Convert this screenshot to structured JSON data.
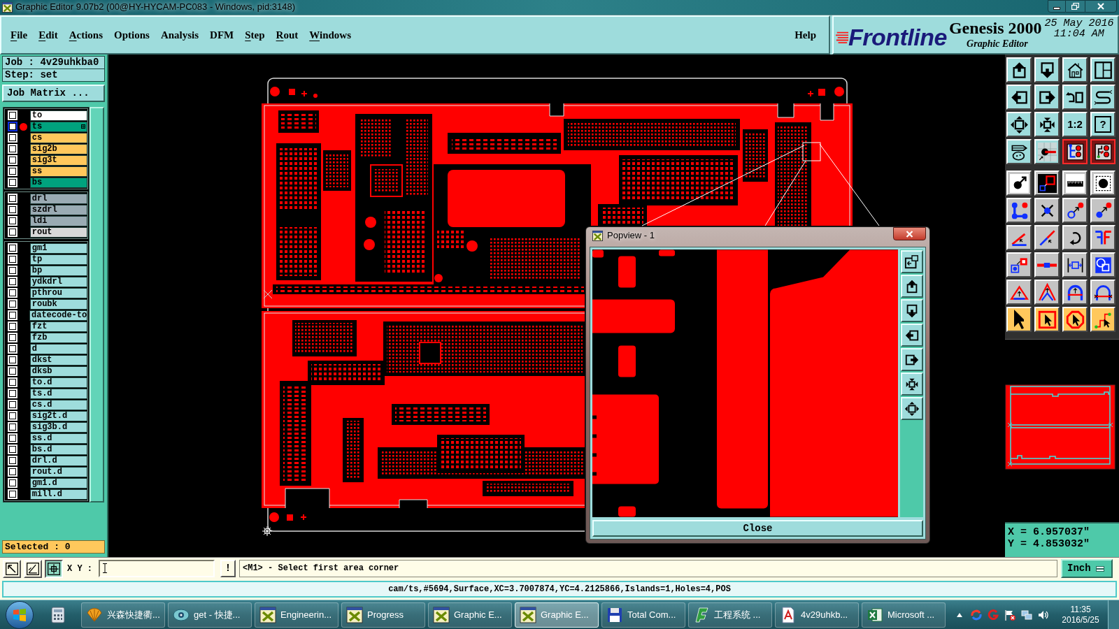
{
  "window": {
    "title": "Graphic Editor 9.07b2 (00@HY-HYCAM-PC083 - Windows, pid:3148)"
  },
  "menu": {
    "items": [
      {
        "label": "File",
        "mnemonic": true
      },
      {
        "label": "Edit",
        "mnemonic": true
      },
      {
        "label": "Actions",
        "mnemonic": true
      },
      {
        "label": "Options",
        "mnemonic": false
      },
      {
        "label": "Analysis",
        "mnemonic": false
      },
      {
        "label": "DFM",
        "mnemonic": false
      },
      {
        "label": "Step",
        "mnemonic": true
      },
      {
        "label": "Rout",
        "mnemonic": true
      },
      {
        "label": "Windows",
        "mnemonic": true
      }
    ],
    "help": "Help"
  },
  "brand": {
    "logo": "Frontline",
    "product": "Genesis 2000",
    "subtitle": "Graphic Editor",
    "date": "25 May 2016",
    "time": "11:04 AM"
  },
  "job_panel": {
    "job": "Job : 4v29uhkba0",
    "step": "Step: set",
    "matrix_button": "Job Matrix ...",
    "selected": "Selected : 0"
  },
  "layer_groups": [
    {
      "layers": [
        {
          "name": "to",
          "color": "#ffffff",
          "checked": false,
          "active": false
        },
        {
          "name": "ts",
          "color": "#00a27e",
          "checked": false,
          "active": true
        },
        {
          "name": "cs",
          "color": "#ffc85c",
          "checked": false,
          "active": false
        },
        {
          "name": "sig2b",
          "color": "#ffc85c",
          "checked": false,
          "active": false
        },
        {
          "name": "sig3t",
          "color": "#ffc85c",
          "checked": false,
          "active": false
        },
        {
          "name": "ss",
          "color": "#ffc85c",
          "checked": false,
          "active": false
        },
        {
          "name": "bs",
          "color": "#00a27e",
          "checked": false,
          "active": false
        }
      ]
    },
    {
      "layers": [
        {
          "name": "drl",
          "color": "#9aabb3",
          "checked": false,
          "active": false
        },
        {
          "name": "szdrl",
          "color": "#9aabb3",
          "checked": false,
          "active": false
        },
        {
          "name": "ldi",
          "color": "#9aabb3",
          "checked": false,
          "active": false
        },
        {
          "name": "rout",
          "color": "#d8d8d8",
          "checked": false,
          "active": false
        }
      ]
    },
    {
      "layers": [
        {
          "name": "gm1",
          "color": "#9edcdc",
          "checked": false,
          "active": false
        },
        {
          "name": "tp",
          "color": "#9edcdc",
          "checked": false,
          "active": false
        },
        {
          "name": "bp",
          "color": "#9edcdc",
          "checked": false,
          "active": false
        },
        {
          "name": "ydkdrl",
          "color": "#9edcdc",
          "checked": false,
          "active": false
        },
        {
          "name": "pthrou",
          "color": "#9edcdc",
          "checked": false,
          "active": false
        },
        {
          "name": "roubk",
          "color": "#9edcdc",
          "checked": false,
          "active": false
        },
        {
          "name": "datecode-to",
          "color": "#9edcdc",
          "checked": false,
          "active": false
        },
        {
          "name": "fzt",
          "color": "#9edcdc",
          "checked": false,
          "active": false
        },
        {
          "name": "fzb",
          "color": "#9edcdc",
          "checked": false,
          "active": false
        },
        {
          "name": "d",
          "color": "#9edcdc",
          "checked": false,
          "active": false
        },
        {
          "name": "dkst",
          "color": "#9edcdc",
          "checked": false,
          "active": false
        },
        {
          "name": "dksb",
          "color": "#9edcdc",
          "checked": false,
          "active": false
        },
        {
          "name": "to.d",
          "color": "#9edcdc",
          "checked": false,
          "active": false
        },
        {
          "name": "ts.d",
          "color": "#9edcdc",
          "checked": false,
          "active": false
        },
        {
          "name": "cs.d",
          "color": "#9edcdc",
          "checked": false,
          "active": false
        },
        {
          "name": "sig2t.d",
          "color": "#9edcdc",
          "checked": false,
          "active": false
        },
        {
          "name": "sig3b.d",
          "color": "#9edcdc",
          "checked": false,
          "active": false
        },
        {
          "name": "ss.d",
          "color": "#9edcdc",
          "checked": false,
          "active": false
        },
        {
          "name": "bs.d",
          "color": "#9edcdc",
          "checked": false,
          "active": false
        },
        {
          "name": "drl.d",
          "color": "#9edcdc",
          "checked": false,
          "active": false
        },
        {
          "name": "rout.d",
          "color": "#9edcdc",
          "checked": false,
          "active": false
        },
        {
          "name": "gm1.d",
          "color": "#9edcdc",
          "checked": false,
          "active": false
        },
        {
          "name": "mill.d",
          "color": "#9edcdc",
          "checked": false,
          "active": false
        }
      ]
    }
  ],
  "popview": {
    "title": "Popview - 1",
    "close_button": "Close"
  },
  "toolbar": [
    {
      "kind": "view",
      "tools": [
        {
          "on": false
        },
        {
          "on": false
        },
        {
          "on": false
        },
        {
          "on": false
        },
        {
          "on": false
        },
        {
          "on": false
        },
        {
          "on": false
        },
        {
          "on": false
        },
        {
          "on": false
        },
        {
          "on": false
        },
        {
          "label": "1:2",
          "on": false
        },
        {
          "label": "?",
          "on": false
        },
        {
          "on": false
        },
        {
          "on": false
        },
        {
          "on": true
        },
        {
          "on": true
        }
      ]
    },
    {
      "kind": "edit",
      "tools": [
        {
          "on": false
        },
        {
          "on": false
        },
        {
          "on": false
        },
        {
          "on": false
        },
        {
          "on": false
        },
        {
          "on": false
        },
        {
          "on": false
        },
        {
          "on": false
        },
        {
          "on": false
        },
        {
          "on": false
        },
        {
          "on": false
        },
        {
          "on": false
        },
        {
          "on": false
        },
        {
          "on": false
        },
        {
          "on": false
        },
        {
          "on": false
        },
        {
          "on": false
        },
        {
          "on": false
        },
        {
          "on": false
        },
        {
          "on": false
        }
      ]
    },
    {
      "kind": "select",
      "tools": [
        {
          "on": false
        },
        {
          "on": false
        },
        {
          "on": false
        },
        {
          "on": false
        }
      ]
    }
  ],
  "coordinates": {
    "x": "X = 6.957037\"",
    "y": "Y = 4.853032\""
  },
  "command_bar": {
    "tools": [
      {
        "on": false
      },
      {
        "on": false
      },
      {
        "on": true
      }
    ],
    "xy_label": "X Y :",
    "bang_button": "!",
    "message": "<M1> - Select first area corner",
    "units_button": "Inch"
  },
  "status_line": "cam/ts,#5694,Surface,XC=3.7007874,YC=4.2125866,Islands=1,Holes=4,POS",
  "taskbar": {
    "items": [
      {
        "label": "兴森快捷衢...",
        "selected": false
      },
      {
        "label": "get - 快捷...",
        "selected": false
      },
      {
        "label": "Engineerin...",
        "selected": false
      },
      {
        "label": "Progress",
        "selected": false
      },
      {
        "label": "Graphic E...",
        "selected": false
      },
      {
        "label": "Graphic E...",
        "selected": true
      },
      {
        "label": "Total Com...",
        "selected": false
      },
      {
        "label": "工程系统 ...",
        "selected": false
      },
      {
        "label": "4v29uhkb...",
        "selected": false
      },
      {
        "label": "Microsoft ...",
        "selected": false
      }
    ],
    "time": "11:35",
    "date": "2016/5/25"
  }
}
